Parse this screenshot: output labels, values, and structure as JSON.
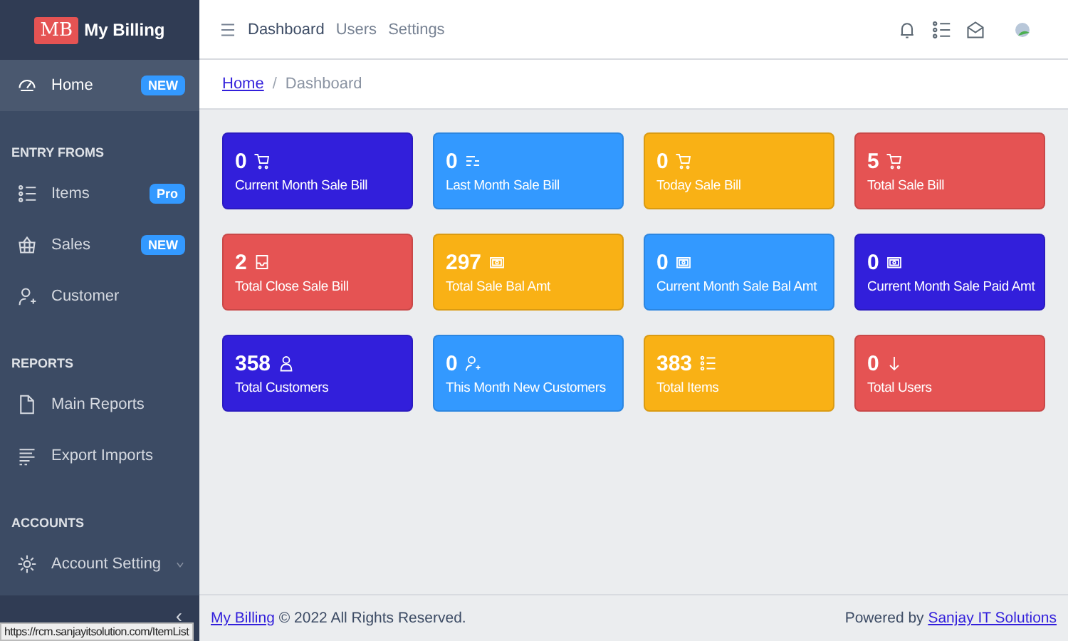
{
  "sidebar": {
    "brand": {
      "logo": "MB",
      "name": "My Billing"
    },
    "items": [
      {
        "kind": "link",
        "label": "Home",
        "selected": true,
        "badge": "NEW"
      },
      {
        "kind": "section",
        "label": "ENTRY FROMS"
      },
      {
        "kind": "link",
        "label": "Items",
        "selected": false,
        "badge": "Pro"
      },
      {
        "kind": "link",
        "label": "Sales",
        "selected": false,
        "badge": "NEW"
      },
      {
        "kind": "link",
        "label": "Customer",
        "selected": false
      },
      {
        "kind": "section",
        "label": "REPORTS"
      },
      {
        "kind": "link",
        "label": "Main Reports",
        "selected": false
      },
      {
        "kind": "link",
        "label": "Export Imports",
        "selected": false
      },
      {
        "kind": "section",
        "label": "ACCOUNTS"
      },
      {
        "kind": "link",
        "label": "Account Setting",
        "selected": false,
        "expanded": false
      }
    ],
    "collapse": "‹"
  },
  "header": {
    "nav": [
      {
        "label": "Dashboard",
        "selected": true
      },
      {
        "label": "Users",
        "selected": false
      },
      {
        "label": "Settings",
        "selected": false
      }
    ]
  },
  "breadcrumb": {
    "separator": "/",
    "items": [
      {
        "label": "Home",
        "link": true
      },
      {
        "label": "Dashboard",
        "link": false
      }
    ]
  },
  "cards": [
    {
      "value": "0",
      "label": "Current Month Sale Bill",
      "color": "#321fdb"
    },
    {
      "value": "0",
      "label": "Last Month Sale Bill",
      "color": "#3399ff"
    },
    {
      "value": "0",
      "label": "Today Sale Bill",
      "color": "#f9b115"
    },
    {
      "value": "5",
      "label": "Total Sale Bill",
      "color": "#e55353"
    },
    {
      "value": "2",
      "label": "Total Close Sale Bill",
      "color": "#e55353"
    },
    {
      "value": "297",
      "label": "Total Sale Bal Amt",
      "color": "#f9b115"
    },
    {
      "value": "0",
      "label": "Current Month Sale Bal Amt",
      "color": "#3399ff"
    },
    {
      "value": "0",
      "label": "Current Month Sale Paid Amt",
      "color": "#321fdb"
    },
    {
      "value": "358",
      "label": "Total Customers",
      "color": "#321fdb"
    },
    {
      "value": "0",
      "label": "This Month New Customers",
      "color": "#3399ff"
    },
    {
      "value": "383",
      "label": "Total Items",
      "color": "#f9b115"
    },
    {
      "value": "0",
      "label": "Total Users",
      "color": "#e55353"
    }
  ],
  "footer": {
    "brand_link": "My Billing",
    "copyright": "© 2022 All Rights Reserved.",
    "powered_by": "Powered by",
    "company_link": "Sanjay IT Solutions"
  },
  "status_url": "https://rcm.sanjayitsolution.com/ItemList"
}
